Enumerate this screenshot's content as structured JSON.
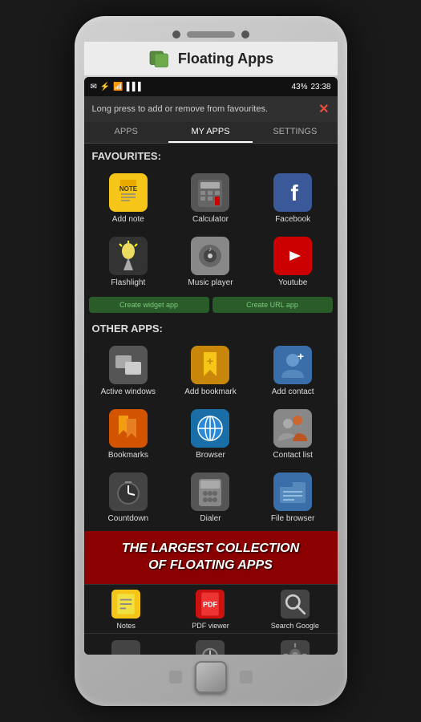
{
  "app": {
    "name": "Floating Apps",
    "logo_icon": "📱"
  },
  "status_bar": {
    "left_icons": [
      "✉"
    ],
    "right_text": "43%",
    "time": "23:38",
    "battery": "43%"
  },
  "toast": {
    "message": "Long press to add or remove from favourites.",
    "close_icon": "✕"
  },
  "tabs": [
    {
      "label": "APPS",
      "active": false
    },
    {
      "label": "MY APPS",
      "active": true
    },
    {
      "label": "SETTINGS",
      "active": false
    }
  ],
  "favourites_section": {
    "title": "FAVOURITES:",
    "apps": [
      {
        "label": "Add note",
        "icon": "📝",
        "bg": "#f5c518"
      },
      {
        "label": "Calculator",
        "icon": "🔢",
        "bg": "#555555"
      },
      {
        "label": "Facebook",
        "icon": "f",
        "bg": "#3b5998"
      },
      {
        "label": "Flashlight",
        "icon": "💡",
        "bg": "#333333"
      },
      {
        "label": "Music player",
        "icon": "🎵",
        "bg": "#888888"
      },
      {
        "label": "Youtube",
        "icon": "▶",
        "bg": "#cc0000"
      }
    ]
  },
  "widget_buttons": [
    {
      "label": "Create widget app"
    },
    {
      "label": "Create URL app"
    }
  ],
  "other_apps_section": {
    "title": "OTHER APPS:",
    "apps": [
      {
        "label": "Active windows",
        "icon": "🗗",
        "bg": "#555555"
      },
      {
        "label": "Add bookmark",
        "icon": "🔖",
        "bg": "#c8860a"
      },
      {
        "label": "Add contact",
        "icon": "👤",
        "bg": "#3a6ea8"
      },
      {
        "label": "Bookmarks",
        "icon": "📚",
        "bg": "#d35400"
      },
      {
        "label": "Browser",
        "icon": "🌐",
        "bg": "#1a6ea8"
      },
      {
        "label": "Contact list",
        "icon": "👥",
        "bg": "#888888"
      },
      {
        "label": "Countdown",
        "icon": "⏱",
        "bg": "#444444"
      },
      {
        "label": "Dialer",
        "icon": "📞",
        "bg": "#555555"
      },
      {
        "label": "File browser",
        "icon": "📁",
        "bg": "#3a6ea8"
      }
    ]
  },
  "promo": {
    "line1": "THE LARGEST COLLECTION",
    "line2": "OF FLOATING APPS"
  },
  "bottom_apps": [
    {
      "label": "Notes",
      "icon": "📒",
      "bg": "#f0e040"
    },
    {
      "label": "PDF viewer",
      "icon": "📄",
      "bg": "#cc1111"
    },
    {
      "label": "Search Google",
      "icon": "🔍",
      "bg": "#444444"
    }
  ],
  "more_apps": [
    {
      "icon": "👟",
      "bg": "#444"
    },
    {
      "icon": "⏱",
      "bg": "#444"
    },
    {
      "icon": "⚙",
      "bg": "#444"
    }
  ]
}
